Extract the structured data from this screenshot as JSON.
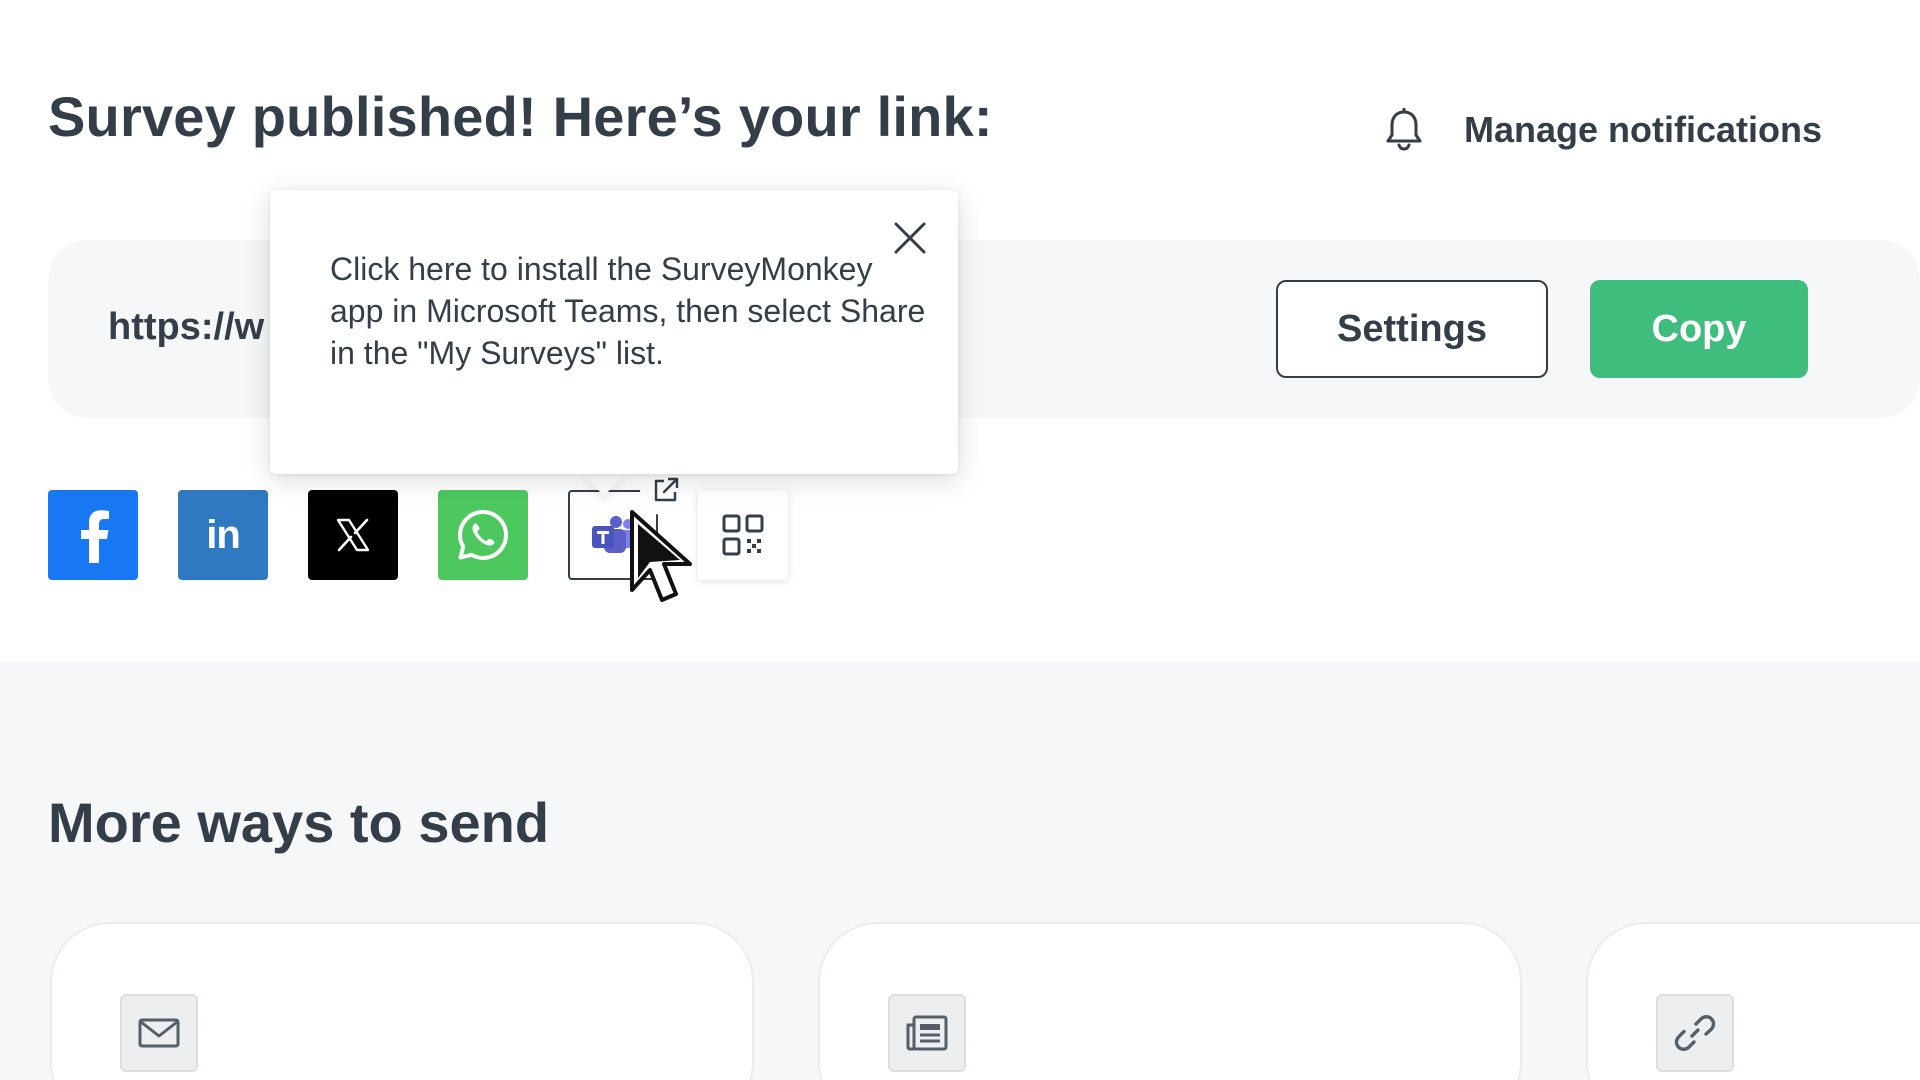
{
  "header": {
    "title": "Survey published! Here’s your link:",
    "manage_notifications": "Manage notifications"
  },
  "link_bar": {
    "url_text": "https://w",
    "settings_label": "Settings",
    "copy_label": "Copy"
  },
  "colors": {
    "copy_button": "#3ebd7c",
    "facebook": "#1877f2",
    "linkedin": "#2f79c0",
    "x": "#000000",
    "whatsapp": "#4cc85f",
    "teams_purple": "#5b5fc7",
    "text": "#333e48"
  },
  "share_icons": [
    {
      "name": "facebook-icon",
      "glyph": "f"
    },
    {
      "name": "linkedin-icon",
      "glyph": "in"
    },
    {
      "name": "x-icon",
      "glyph": "𝕏"
    },
    {
      "name": "whatsapp-icon"
    },
    {
      "name": "microsoft-teams-icon"
    },
    {
      "name": "qr-code-icon"
    }
  ],
  "tooltip": {
    "text": "Click here to install the SurveyMonkey app in Microsoft Teams, then select Share in the \"My Surveys\" list."
  },
  "more_ways": {
    "title": "More ways to send",
    "cards": [
      {
        "icon": "mail-icon"
      },
      {
        "icon": "web-form-icon"
      },
      {
        "icon": "link-icon"
      }
    ]
  }
}
